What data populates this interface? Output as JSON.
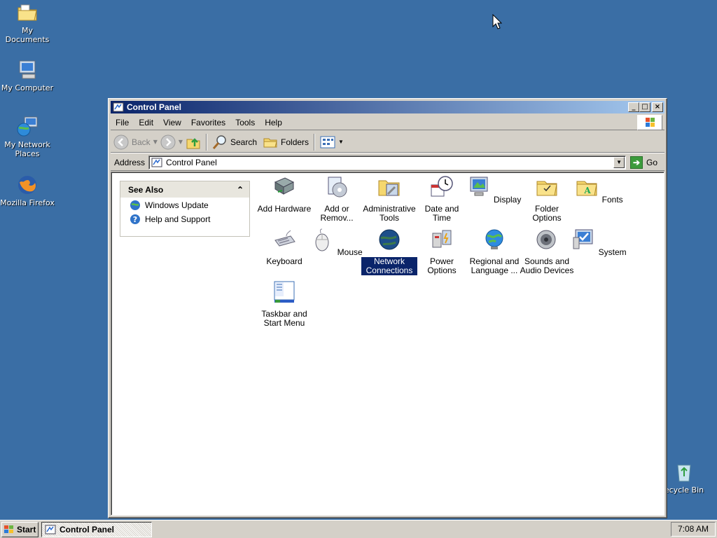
{
  "desktop": {
    "icons": [
      {
        "label": "My Documents",
        "icon": "folder-documents-icon"
      },
      {
        "label": "My Computer",
        "icon": "computer-icon"
      },
      {
        "label": "My Network Places",
        "icon": "network-places-icon"
      },
      {
        "label": "Mozilla Firefox",
        "icon": "firefox-icon"
      },
      {
        "label": "ecycle Bin",
        "icon": "recycle-bin-icon"
      }
    ],
    "background_color": "#3a6ea5"
  },
  "window": {
    "title": "Control Panel",
    "menu": [
      "File",
      "Edit",
      "View",
      "Favorites",
      "Tools",
      "Help"
    ],
    "toolbar": {
      "back_label": "Back",
      "search_label": "Search",
      "folders_label": "Folders"
    },
    "address": {
      "label": "Address",
      "value": "Control Panel",
      "go_label": "Go"
    },
    "see_also": {
      "title": "See Also",
      "items": [
        {
          "label": "Windows Update",
          "icon": "windows-update-icon"
        },
        {
          "label": "Help and Support",
          "icon": "help-icon"
        }
      ]
    },
    "items": [
      {
        "label": "Add Hardware",
        "icon": "add-hardware-icon"
      },
      {
        "label": "Add or Remov...",
        "icon": "add-remove-programs-icon"
      },
      {
        "label": "Administrative Tools",
        "icon": "admin-tools-icon"
      },
      {
        "label": "Date and Time",
        "icon": "date-time-icon"
      },
      {
        "label": "Display",
        "icon": "display-icon"
      },
      {
        "label": "Folder Options",
        "icon": "folder-options-icon"
      },
      {
        "label": "Fonts",
        "icon": "fonts-icon"
      },
      {
        "label": "Keyboard",
        "icon": "keyboard-icon"
      },
      {
        "label": "Mouse",
        "icon": "mouse-icon"
      },
      {
        "label": "Network Connections",
        "icon": "network-connections-icon",
        "selected": true
      },
      {
        "label": "Power Options",
        "icon": "power-options-icon"
      },
      {
        "label": "Regional and Language ...",
        "icon": "regional-language-icon"
      },
      {
        "label": "Sounds and Audio Devices",
        "icon": "sounds-icon"
      },
      {
        "label": "System",
        "icon": "system-icon"
      },
      {
        "label": "Taskbar and Start Menu",
        "icon": "taskbar-start-menu-icon"
      }
    ]
  },
  "taskbar": {
    "start_label": "Start",
    "task_label": "Control Panel",
    "clock": "7:08 AM"
  },
  "colors": {
    "title_gradient_start": "#0a246a",
    "title_gradient_end": "#a6caf0",
    "selection": "#0a246a"
  }
}
